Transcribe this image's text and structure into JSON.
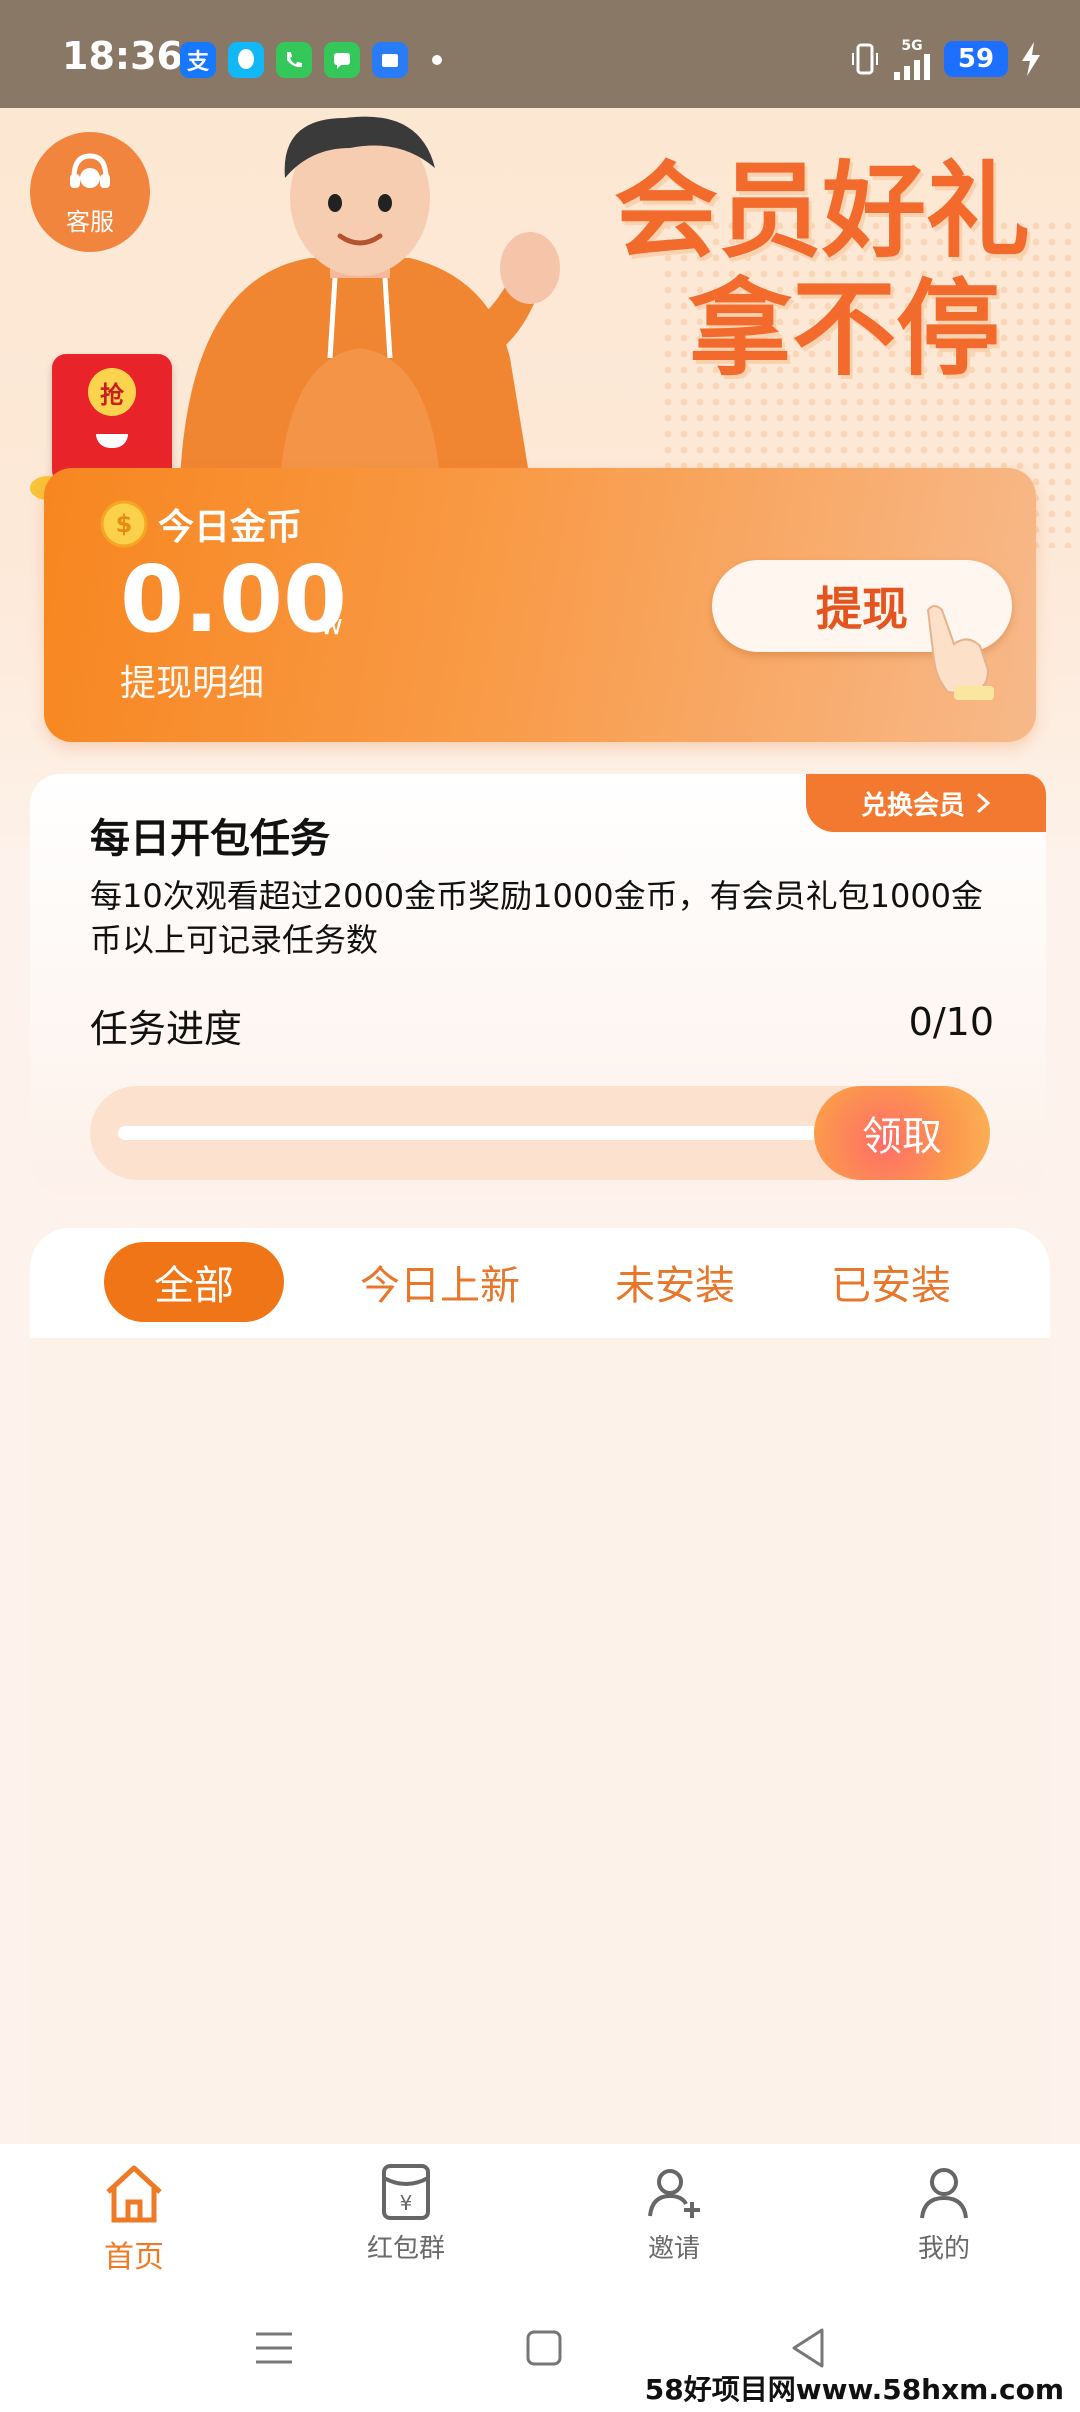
{
  "status_bar": {
    "time": "18:36",
    "network": "5G",
    "battery": "59",
    "apps": [
      {
        "icon": "alipay-icon",
        "glyph": "支",
        "color": "#1677ff"
      },
      {
        "icon": "qq-icon",
        "glyph": "",
        "color": "#12b7f5"
      },
      {
        "icon": "phone-icon",
        "glyph": "",
        "color": "#34c759"
      },
      {
        "icon": "message-icon",
        "glyph": "",
        "color": "#34c759"
      },
      {
        "icon": "files-icon",
        "glyph": "",
        "color": "#2a7bf6"
      }
    ]
  },
  "hero": {
    "service_label": "客服",
    "title_line1": "会员好礼",
    "title_line2": "拿不停",
    "red_packet_label": "抢"
  },
  "coin_card": {
    "label": "今日金币",
    "amount": "0.00",
    "unit": "w",
    "detail_link": "提现明细",
    "withdraw_label": "提现"
  },
  "task": {
    "exchange_label": "兑换会员",
    "title": "每日开包任务",
    "description": "每10次观看超过2000金币奖励1000金币，有会员礼包1000金币以上可记录任务数",
    "progress_label": "任务进度",
    "progress_text": "0/10",
    "progress_value": 0,
    "claim_label": "领取"
  },
  "tabs": [
    {
      "label": "全部",
      "active": true
    },
    {
      "label": "今日上新",
      "active": false
    },
    {
      "label": "未安装",
      "active": false
    },
    {
      "label": "已安装",
      "active": false
    }
  ],
  "bottom_nav": [
    {
      "label": "首页",
      "icon": "home-icon",
      "active": true
    },
    {
      "label": "红包群",
      "icon": "red-packet-group-icon",
      "active": false
    },
    {
      "label": "邀请",
      "icon": "invite-icon",
      "active": false
    },
    {
      "label": "我的",
      "icon": "profile-icon",
      "active": false
    }
  ],
  "watermark": "58好项目网www.58hxm.com",
  "colors": {
    "accent": "#f07516",
    "status_bar": "#8a7866",
    "title": "#f26b2c"
  }
}
